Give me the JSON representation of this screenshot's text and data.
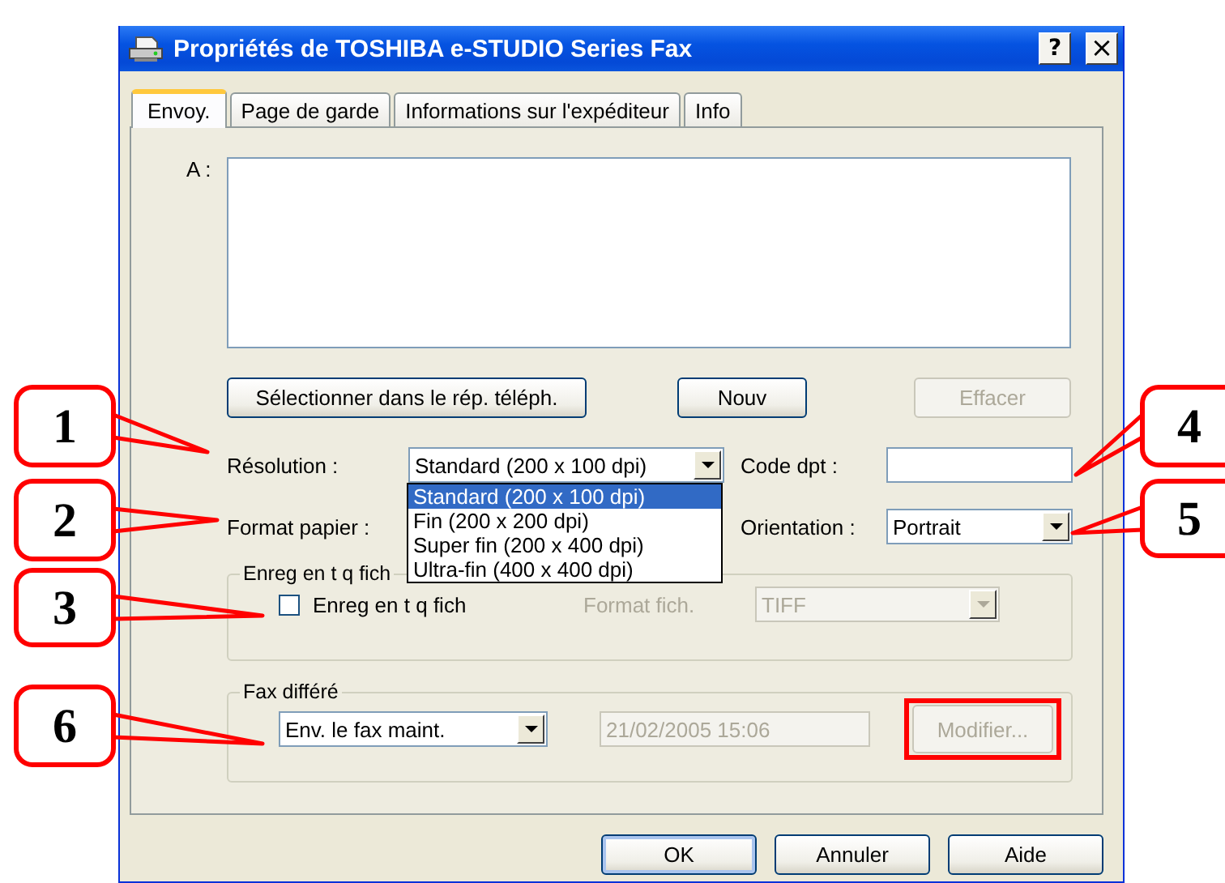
{
  "window": {
    "title": "Propriétés de TOSHIBA e-STUDIO Series Fax",
    "buttons": [
      {
        "kind": "help",
        "label": "?"
      },
      {
        "kind": "close",
        "label": "×"
      }
    ]
  },
  "tabs": [
    {
      "label": "Envoy.",
      "selected": true
    },
    {
      "label": "Page de garde",
      "selected": false
    },
    {
      "label": "Informations sur l'expéditeur",
      "selected": false
    },
    {
      "label": "Info",
      "selected": false
    }
  ],
  "recipient": {
    "label": "A :"
  },
  "recipient_buttons": [
    {
      "label": "Sélectionner dans le rép. téléph.",
      "disabled": false
    },
    {
      "label": "Nouv",
      "disabled": false
    },
    {
      "label": "Effacer",
      "disabled": true
    }
  ],
  "resolution": {
    "label": "Résolution :",
    "value": "Standard (200 x 100 dpi)",
    "expanded": true,
    "options": [
      {
        "label": "Standard (200 x 100 dpi)",
        "selected": true
      },
      {
        "label": "Fin (200 x 200 dpi)",
        "selected": false
      },
      {
        "label": "Super fin (200 x 400 dpi)",
        "selected": false
      },
      {
        "label": "Ultra-fin (400 x 400 dpi)",
        "selected": false
      }
    ]
  },
  "department_code": {
    "label": "Code dpt :"
  },
  "paper_format": {
    "label": "Format papier :"
  },
  "orientation": {
    "label": "Orientation :",
    "value": "Portrait"
  },
  "save_group": {
    "title": "Enreg en t q fich",
    "checkbox": {
      "label": "Enreg en t q fich",
      "checked": false
    },
    "file_format": {
      "label": "Format fich.",
      "value": "TIFF",
      "disabled": true
    }
  },
  "delayed_fax": {
    "title": "Fax différé",
    "mode": {
      "value": "Env. le fax maint."
    },
    "datetime": {
      "value": "21/02/2005 15:06",
      "disabled": true
    },
    "modify_button": {
      "label": "Modifier...",
      "disabled": true,
      "highlighted": true
    }
  },
  "dialog_buttons": [
    {
      "label": "OK",
      "default": true
    },
    {
      "label": "Annuler",
      "default": false
    },
    {
      "label": "Aide",
      "default": false
    }
  ],
  "callouts": [
    {
      "number": "1"
    },
    {
      "number": "4"
    },
    {
      "number": "2"
    },
    {
      "number": "5"
    },
    {
      "number": "3"
    },
    {
      "number": "6"
    }
  ]
}
